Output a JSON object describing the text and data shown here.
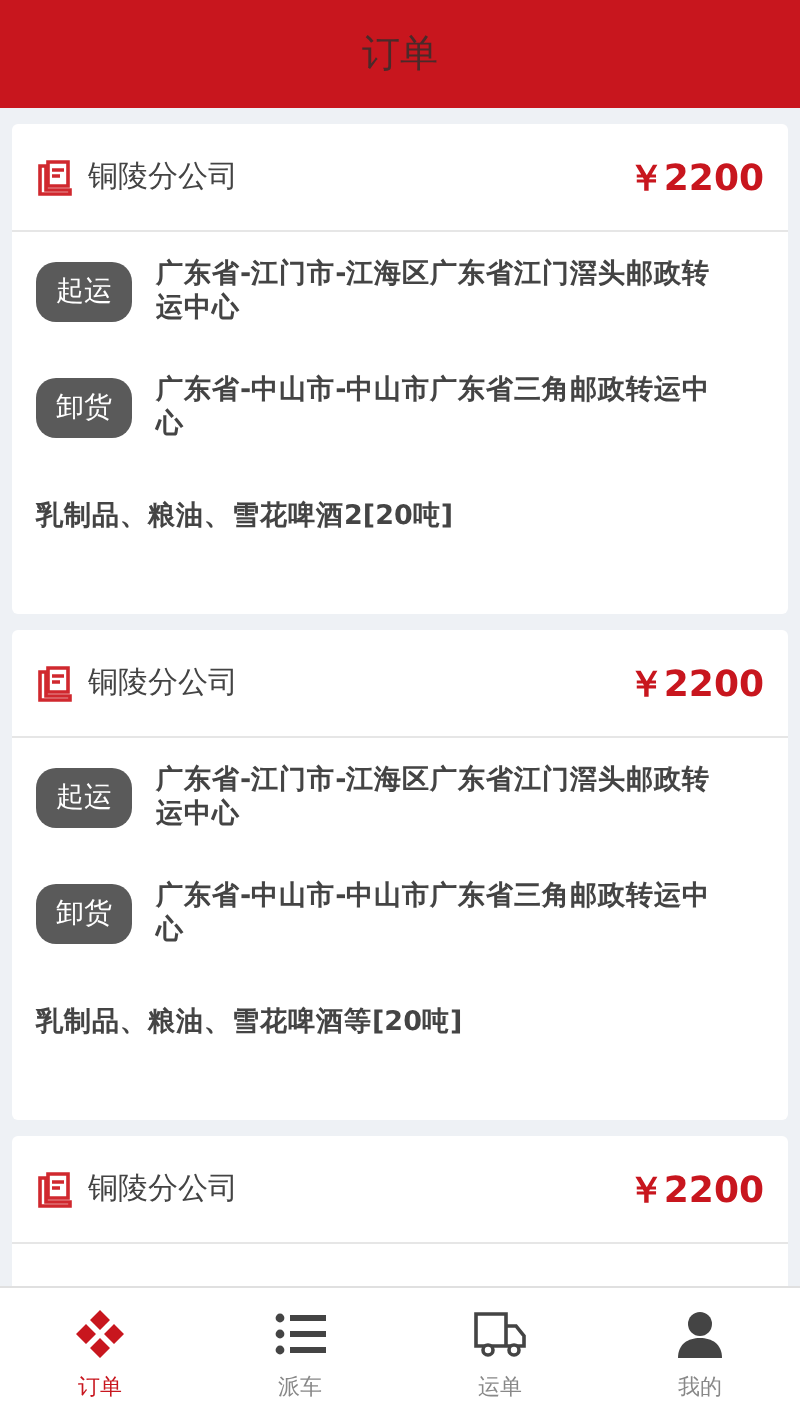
{
  "header": {
    "title": "订单"
  },
  "orders": [
    {
      "company": "铜陵分公司",
      "price": "￥2200",
      "stops": [
        {
          "tag": "起运",
          "address": "广东省-江门市-江海区广东省江门滘头邮政转运中心"
        },
        {
          "tag": "卸货",
          "address": "广东省-中山市-中山市广东省三角邮政转运中心"
        }
      ],
      "goods": "乳制品、粮油、雪花啤酒2[20吨]"
    },
    {
      "company": "铜陵分公司",
      "price": "￥2200",
      "stops": [
        {
          "tag": "起运",
          "address": "广东省-江门市-江海区广东省江门滘头邮政转运中心"
        },
        {
          "tag": "卸货",
          "address": "广东省-中山市-中山市广东省三角邮政转运中心"
        }
      ],
      "goods": "乳制品、粮油、雪花啤酒等[20吨]"
    },
    {
      "company": "铜陵分公司",
      "price": "￥2200"
    }
  ],
  "tabbar": [
    {
      "kind": "orders",
      "label": "订单",
      "selected": true
    },
    {
      "kind": "list",
      "label": "派车",
      "selected": false
    },
    {
      "kind": "truck",
      "label": "运单",
      "selected": false
    },
    {
      "kind": "user",
      "label": "我的",
      "selected": false
    }
  ]
}
